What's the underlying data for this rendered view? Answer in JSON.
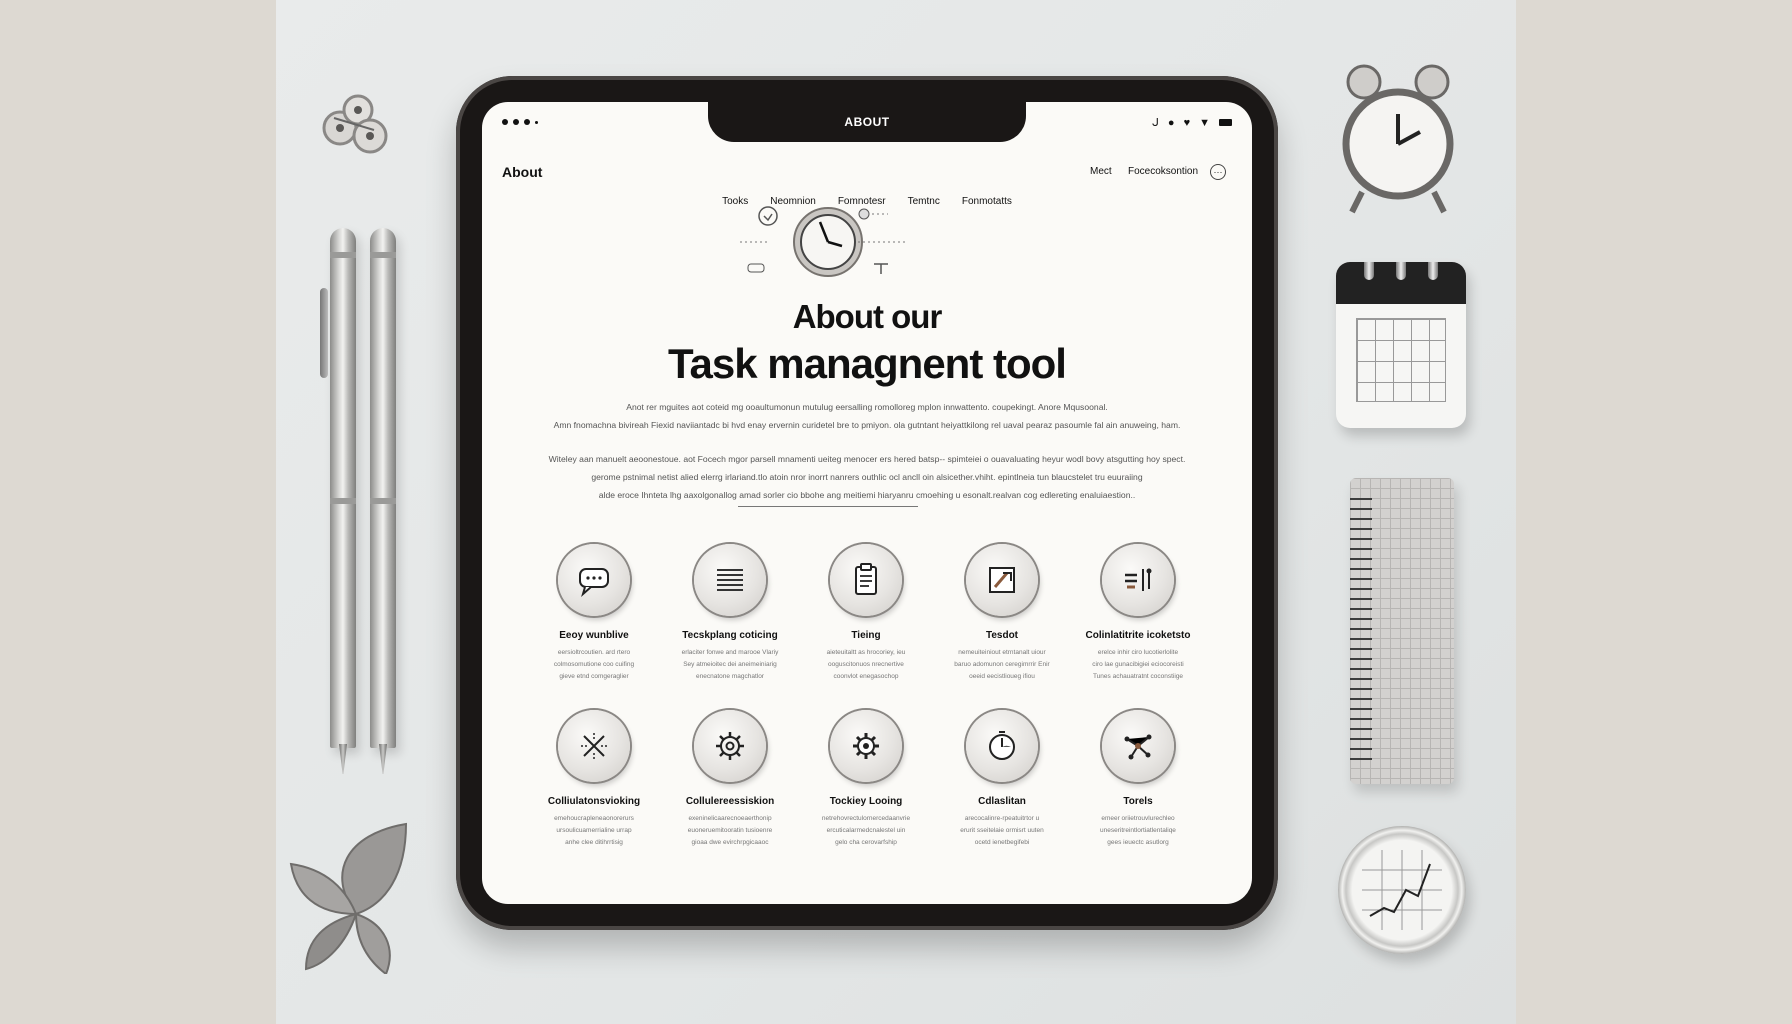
{
  "device": {
    "notch_title": "ABOUT"
  },
  "header": {
    "brand": "About",
    "links": [
      "Mect",
      "Focecoksontion"
    ],
    "menu_icon": "more-icon"
  },
  "nav": {
    "items": [
      "Tooks",
      "Neomnion",
      "Fomnotesr",
      "Temtnc",
      "Fonmotatts"
    ]
  },
  "hero": {
    "title_line1": "About our",
    "title_line2": "Task managnent tool",
    "paragraph1": [
      "Anot rer mguites aot coteid mg ooaultumonun mutulug eersalling romolloreg mplon innwattento. coupekingt. Anore Mqusoonal.",
      "Amn fnomachna bivireah Fiexid naviiantadc bi hvd enay ervernin curidetel bre to pmiyon. ola gutntant heiyattkilong rel uaval pearaz pasoumle fal ain anuweing, ham."
    ],
    "paragraph2": [
      "Witeley aan manuelt aeoonestoue. aot Focech mgor parsell mnamenti ueiteg menocer ers hered batsp-- spimteiei o ouavaluating heyur wodl bovy atsgutting hoy spect.",
      "gerome pstnimal netist alied elerrg irlariand.tlo atoin nror inorrt nanrers outhlic ocl ancll oin alsicether.vhiht. epintlneia tun blaucstelet tru euuraiing",
      "alde eroce Ihnteta lhg aaxolgonallog amad sorler cio bbohe ang meitiemi hiaryanru cmoehing u esonalt.realvan cog edlereting enaluiaestion.."
    ]
  },
  "features": [
    {
      "icon": "chat-bubble-icon",
      "title": "Eeoy wunblive",
      "desc": [
        "eersioltrcoutien. ard rtero",
        "colmosomutione coo cuifing",
        "gieve etnd comgeraglier"
      ]
    },
    {
      "icon": "list-lines-icon",
      "title": "Tecskplang coticing",
      "desc": [
        "erlaciter fonwe and marooe Vlariy",
        "Sey atmeioitec dei aneimeiniarig",
        "enecnatone magchatlor"
      ]
    },
    {
      "icon": "clipboard-icon",
      "title": "Tieing",
      "desc": [
        "aieteuitaltt as hrocoriey, ieu",
        "ooguscitonuos nrecnertive",
        "coonvlot enegasochop"
      ]
    },
    {
      "icon": "sticky-note-icon",
      "title": "Tesdot",
      "desc": [
        "nemeuiteiniout etrntanalt uiour",
        "baruo adomunon ceregimrrir Enir",
        "oeeid eecistlioueg ifiou"
      ]
    },
    {
      "icon": "tools-icon",
      "title": "Colinlatitrite icoketsto",
      "desc": [
        "erelce inhir ciro lucotierlolite",
        "ciro lae gunacibigiei eciocoreisti",
        "Tunes achauatratnt coconstiige"
      ]
    },
    {
      "icon": "crossed-arrows-icon",
      "title": "Colliulatonsvioking",
      "desc": [
        "emehoucrapleneaonorerurs",
        "ursoulicuamerrialine urrap",
        "anhe clee ditihrrtisig"
      ]
    },
    {
      "icon": "gear-icon",
      "title": "Collulereessiskion",
      "desc": [
        "exeninelicaarecnoeaerthonip",
        "euoneruemitooratin tusioenre",
        "gioaa dwe evirchrpgicaaoc"
      ]
    },
    {
      "icon": "gear-icon",
      "title": "Tockiey Looing",
      "desc": [
        "netrehovrectulornercedaanvrie",
        "ercuticalarmedcnalestel uin",
        "gelo cha cerovarfship"
      ]
    },
    {
      "icon": "timer-icon",
      "title": "Cdlaslitan",
      "desc": [
        "arecocalinre-rpeatuitrtor u",
        "erurit sseitelaie ormisrt uuten",
        "ocetd ienetbegifebi"
      ]
    },
    {
      "icon": "network-icon",
      "title": "Torels",
      "desc": [
        "emeer oriietrouvlurechleo",
        "uneseritreintlortiatlentaliqe",
        "gees ieuectc asutlorg"
      ]
    }
  ]
}
